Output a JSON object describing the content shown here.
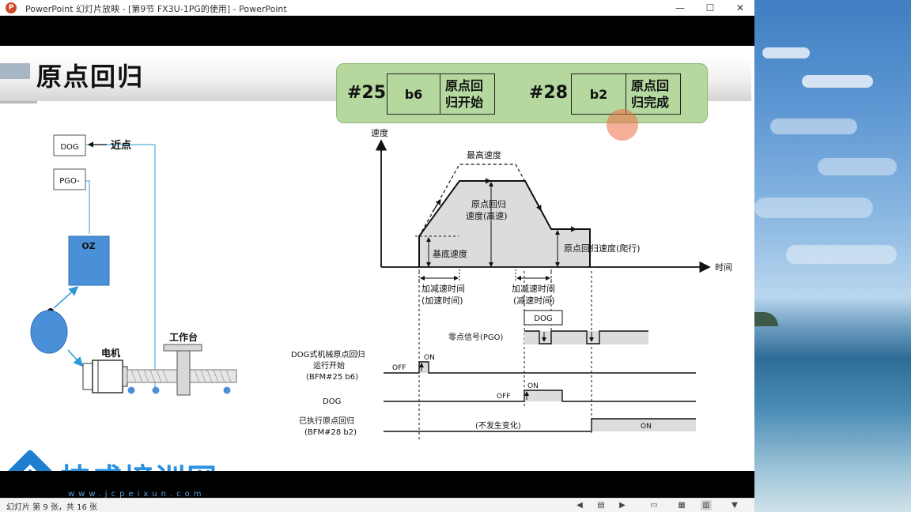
{
  "window": {
    "app_icon_glyph": "P",
    "title": "PowerPoint 幻灯片放映 - [第9节  FX3U-1PG的使用] - PowerPoint",
    "minimize_glyph": "—",
    "maximize_glyph": "☐",
    "close_glyph": "✕"
  },
  "slide": {
    "title": "原点回归",
    "bfm": [
      {
        "num": "#25",
        "bit": "b6",
        "desc_line1": "原点回",
        "desc_line2": "归开始"
      },
      {
        "num": "#28",
        "bit": "b2",
        "desc_line1": "原点回",
        "desc_line2": "归完成"
      }
    ],
    "mechanism": {
      "dog_label": "DOG",
      "near_point_label": "近点",
      "pgo_label": "PGO-",
      "oz_label": "OZ",
      "motor_label": "电机",
      "table_label": "工作台"
    },
    "speed_chart": {
      "y_axis_label": "速度",
      "x_axis_label": "时间",
      "max_speed_label": "最高速度",
      "home_speed_label_1": "原点回归",
      "home_speed_label_2": "速度(高速)",
      "base_speed_label": "基底速度",
      "creep_speed_label": "原点回归速度(爬行)",
      "accel_label_1": "加减速时间",
      "accel_label_2": "(加速时间)",
      "decel_label_1": "加减速时间",
      "decel_label_2": "(减速时间)"
    },
    "timing": {
      "dog_box_label": "DOG",
      "pgo_signal_label": "零点信号(PGO)",
      "start_label_1": "DOG式机械原点回归",
      "start_label_2": "运行开始",
      "start_label_3": "(BFM#25 b6)",
      "off_label_1": "OFF",
      "on_label_1": "ON",
      "dog_row_label": "DOG",
      "off_label_2": "OFF",
      "on_label_2": "ON",
      "done_label_1": "已执行原点回归",
      "done_label_2": "(BFM#28 b2)",
      "no_change_label": "(不发生变化)",
      "on_label_3": "ON"
    },
    "watermark": {
      "brand": "技成培训网",
      "url": "www.jcpeixun.com"
    }
  },
  "statusbar": {
    "slide_info": "幻灯片 第 9 张，共 16 张",
    "prev_glyph": "◀",
    "menu_glyph": "▤",
    "next_glyph": "▶",
    "normal_view_glyph": "▭",
    "sorter_view_glyph": "▦",
    "reading_view_glyph": "▥",
    "slideshow_glyph": "▼"
  },
  "colors": {
    "green_box": "#b4d89e",
    "mechanism_blue": "#4a90d9",
    "line_blue": "#49b4e0",
    "logo_blue": "#1e7fd0"
  }
}
